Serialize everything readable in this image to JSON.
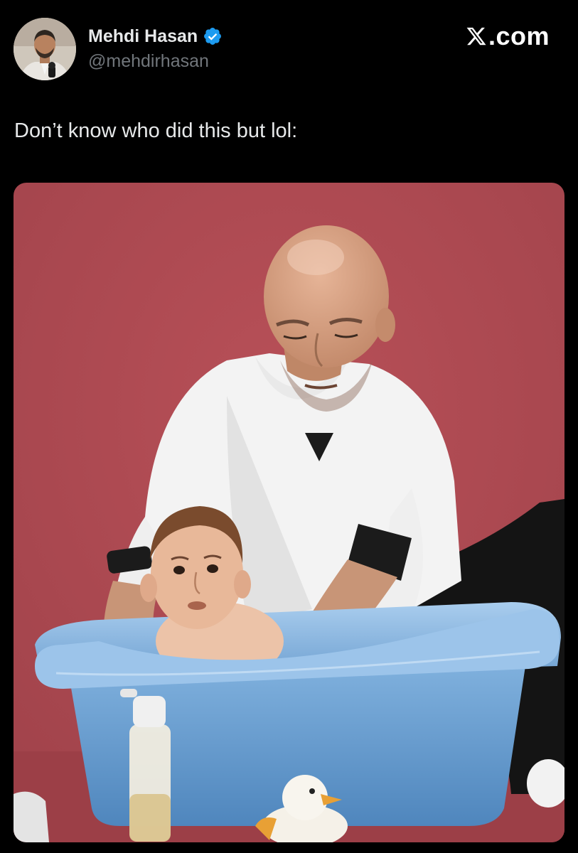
{
  "author": {
    "display_name": "Mehdi Hasan",
    "handle": "@mehdirhasan",
    "verified": true,
    "verified_color": "#1d9bf0"
  },
  "brand": {
    "text": ".com"
  },
  "tweet": {
    "text": "Don’t know who did this but lol:"
  },
  "media": {
    "type": "photo",
    "background_color": "#b04a52"
  },
  "icons": {
    "avatar": "profile-photo",
    "verified": "verified-badge-icon",
    "brand": "x-logo-icon"
  },
  "colors": {
    "background": "#000000",
    "text_primary": "#e7e9ea",
    "text_secondary": "#71767b"
  }
}
